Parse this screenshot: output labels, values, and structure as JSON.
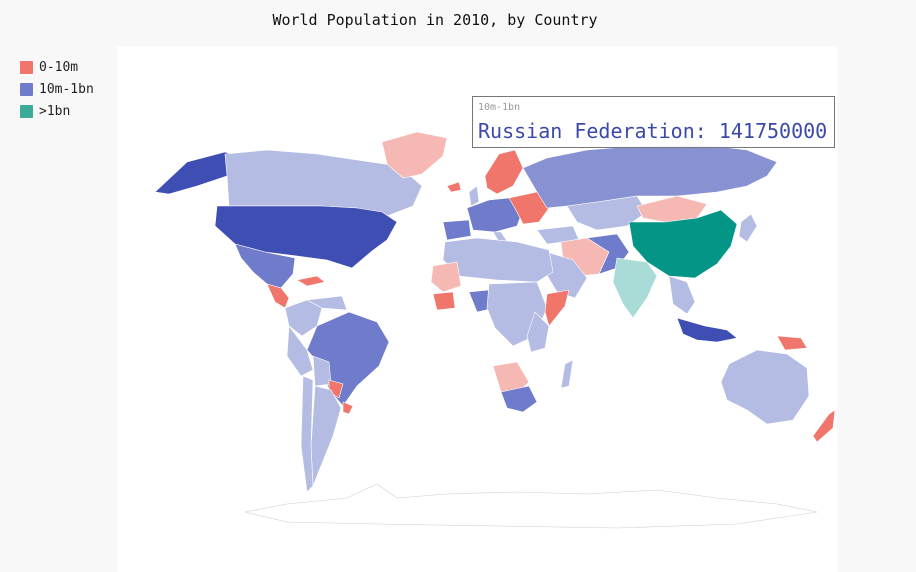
{
  "title": "World Population in 2010, by Country",
  "legend": [
    {
      "label": "0-10m",
      "color": "#f0756b"
    },
    {
      "label": "10m-1bn",
      "color": "#6f7ccb"
    },
    {
      "label": ">1bn",
      "color": "#3aaa9b"
    }
  ],
  "tooltip": {
    "series": "10m-1bn",
    "text": "Russian Federation: 141750000"
  },
  "colors": {
    "small": "#f0756b",
    "small_light": "#f6b8b3",
    "mid": "#6f7ccb",
    "mid_light": "#b5bce3",
    "mid_dark": "#3f4eb3",
    "large": "#039686",
    "large_light": "#a9dcd6"
  }
}
